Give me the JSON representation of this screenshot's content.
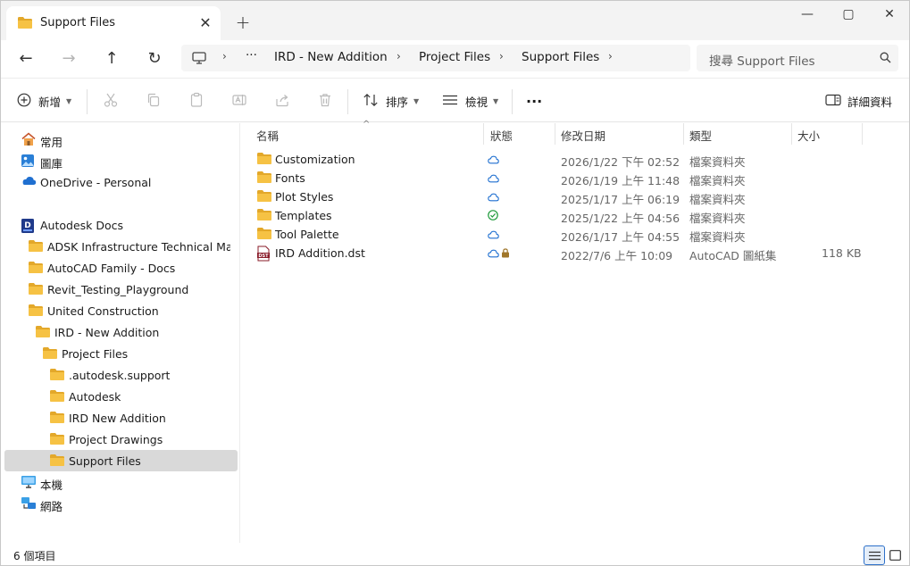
{
  "window": {
    "tab_title": "Support Files",
    "tab_close": "✕",
    "new_tab": "+",
    "minimize": "—",
    "maximize": "▢",
    "close": "✕"
  },
  "nav": {
    "back": "←",
    "forward": "→",
    "up": "↑",
    "refresh": "↻",
    "breadcrumb": [
      "IRD - New Addition",
      "Project Files",
      "Support Files"
    ],
    "ellipsis": "···",
    "chevron": "›",
    "search_placeholder": "搜尋 Support Files"
  },
  "toolbar": {
    "new_label": "新增",
    "sort_label": "排序",
    "view_label": "檢視",
    "more_label": "···",
    "details_label": "詳細資料"
  },
  "sidebar": {
    "items": [
      {
        "label": "常用"
      },
      {
        "label": "圖庫"
      },
      {
        "label": "OneDrive - Personal"
      },
      {
        "label": "Autodesk Docs"
      },
      {
        "label": "ADSK Infrastructure Technical Marketi"
      },
      {
        "label": "AutoCAD Family - Docs"
      },
      {
        "label": "Revit_Testing_Playground"
      },
      {
        "label": "United Construction"
      },
      {
        "label": "IRD - New Addition"
      },
      {
        "label": "Project Files"
      },
      {
        "label": ".autodesk.support"
      },
      {
        "label": "Autodesk"
      },
      {
        "label": "IRD New Addition"
      },
      {
        "label": "Project Drawings"
      },
      {
        "label": "Support Files"
      },
      {
        "label": "本機"
      },
      {
        "label": "網路"
      }
    ]
  },
  "columns": {
    "name": "名稱",
    "status": "狀態",
    "modified": "修改日期",
    "type": "類型",
    "size": "大小",
    "sort_indicator": "^"
  },
  "files": [
    {
      "name": "Customization",
      "modified": "2026/1/22 下午 02:52",
      "type": "檔案資料夾",
      "size": ""
    },
    {
      "name": "Fonts",
      "modified": "2026/1/19 上午 11:48",
      "type": "檔案資料夾",
      "size": ""
    },
    {
      "name": "Plot Styles",
      "modified": "2025/1/17 上午 06:19",
      "type": "檔案資料夾",
      "size": ""
    },
    {
      "name": "Templates",
      "modified": "2025/1/22 上午 04:56",
      "type": "檔案資料夾",
      "size": ""
    },
    {
      "name": "Tool Palette",
      "modified": "2026/1/17 上午 04:55",
      "type": "檔案資料夾",
      "size": ""
    },
    {
      "name": "IRD Addition.dst",
      "modified": "2022/7/6 上午 10:09",
      "type": "AutoCAD 圖紙集",
      "size": "118 KB"
    }
  ],
  "dst_icon_text": "DST",
  "docs_icon_text": "D",
  "statusbar": {
    "count": "6 個項目"
  },
  "colors": {
    "folder": "#f6c244",
    "folder_dark": "#e3a82a",
    "cloud": "#1f6fd0",
    "check": "#1e9a3a",
    "selection": "#d9d9d9",
    "accent": "#2d70c9"
  }
}
